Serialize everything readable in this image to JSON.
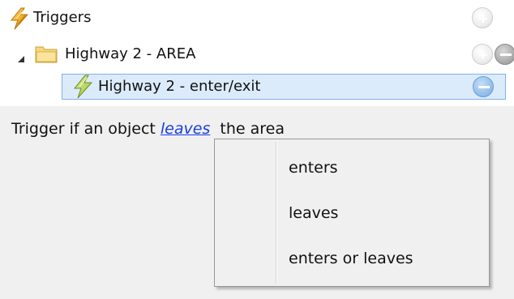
{
  "tree": {
    "root": {
      "label": "Triggers",
      "icon": "lightning-bolt-icon"
    },
    "area": {
      "label": "Highway 2  - AREA",
      "icon": "folder-icon",
      "expanded": true
    },
    "trigger": {
      "label": "Highway 2  - enter/exit",
      "icon": "lightning-bolt-icon",
      "selected": true
    }
  },
  "editor": {
    "sentence_prefix": "Trigger if an object ",
    "selected_verb": "leaves",
    "sentence_suffix": "  the area"
  },
  "menu": {
    "items": [
      {
        "label": "enters"
      },
      {
        "label": "leaves"
      },
      {
        "label": "enters or leaves"
      }
    ]
  },
  "colors": {
    "selection_fill": "#dcebfb",
    "selection_border": "#7fb2e8",
    "link": "#1a3fe0",
    "panel_bg": "#f0f0f0"
  }
}
